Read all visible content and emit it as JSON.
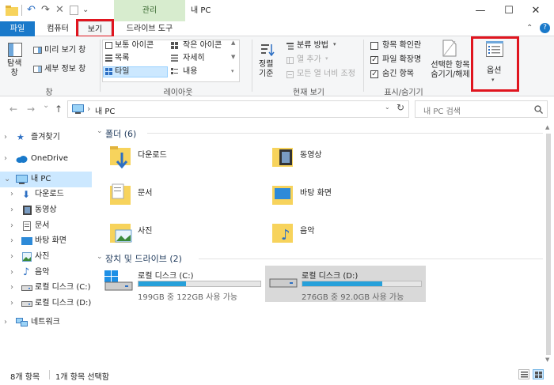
{
  "window": {
    "title": "내 PC",
    "context_tab": "관리",
    "controls": {
      "minimize": "—",
      "maximize": "☐",
      "close": "✕"
    }
  },
  "tabs": {
    "file": "파일",
    "computer": "컴퓨터",
    "view": "보기",
    "drive_tools": "드라이브 도구"
  },
  "ribbon": {
    "panes": {
      "navigation_pane": "탐색\n창",
      "preview_pane": "미리 보기 창",
      "details_pane": "세부 정보 창",
      "group_label": "창"
    },
    "layout": {
      "items": [
        "보통 아이콘",
        "작은 아이콘",
        "목록",
        "자세히",
        "타일",
        "내용"
      ],
      "selected": "타일",
      "group_label": "레이아웃"
    },
    "current_view": {
      "sort": "정렬\n기준",
      "group_by": "분류 방법",
      "add_columns": "열 추가",
      "size_all_columns": "모든 열 너비 조정",
      "group_label": "현재 보기"
    },
    "show_hide": {
      "item_checkboxes": {
        "label": "항목 확인란",
        "checked": false
      },
      "file_extensions": {
        "label": "파일 확장명",
        "checked": true
      },
      "hidden_items": {
        "label": "숨긴 항목",
        "checked": true
      },
      "hide_selected": "선택한 항목\n숨기기/해제",
      "group_label": "표시/숨기기"
    },
    "options": {
      "label": "옵션"
    }
  },
  "address": {
    "back_icon": "←",
    "forward_icon": "→",
    "recent_icon": "⌄",
    "up_icon": "↑",
    "path_sep": "›",
    "path": "내 PC",
    "search_placeholder": "내 PC 검색"
  },
  "nav": [
    {
      "label": "즐겨찾기",
      "icon": "star-icon"
    },
    {
      "label": "OneDrive",
      "icon": "cloud-icon"
    },
    {
      "label": "내 PC",
      "icon": "pc-icon",
      "selected": true
    },
    {
      "label": "다운로드",
      "icon": "download-icon"
    },
    {
      "label": "동영상",
      "icon": "video-icon"
    },
    {
      "label": "문서",
      "icon": "document-icon"
    },
    {
      "label": "바탕 화면",
      "icon": "desktop-icon"
    },
    {
      "label": "사진",
      "icon": "picture-icon"
    },
    {
      "label": "음악",
      "icon": "music-icon"
    },
    {
      "label": "로컬 디스크 (C:)",
      "icon": "drive-icon"
    },
    {
      "label": "로컬 디스크 (D:)",
      "icon": "drive-icon"
    },
    {
      "label": "네트워크",
      "icon": "network-icon"
    }
  ],
  "content": {
    "folders_header": "폴더 (6)",
    "folders": [
      {
        "name": "다운로드",
        "icon": "download-folder-icon"
      },
      {
        "name": "동영상",
        "icon": "video-folder-icon"
      },
      {
        "name": "문서",
        "icon": "document-folder-icon"
      },
      {
        "name": "바탕 화면",
        "icon": "desktop-folder-icon"
      },
      {
        "name": "사진",
        "icon": "picture-folder-icon"
      },
      {
        "name": "음악",
        "icon": "music-folder-icon"
      }
    ],
    "drives_header": "장치 및 드라이브 (2)",
    "drives": [
      {
        "name": "로컬 디스크 (C:)",
        "free": "199GB 중 122GB 사용 가능",
        "used_fraction": 0.39
      },
      {
        "name": "로컬 디스크 (D:)",
        "free": "276GB 중 92.0GB 사용 가능",
        "used_fraction": 0.67,
        "selected": true
      }
    ]
  },
  "status": {
    "count": "8개 항목",
    "selected": "1개 항목 선택함"
  },
  "colors": {
    "file_tab": "#1979ca",
    "context_tab": "#d7ecce",
    "highlight": "#e0151f",
    "selection": "#cce8ff",
    "drive_bar": "#26a0da",
    "folder": "#f7d35c"
  }
}
